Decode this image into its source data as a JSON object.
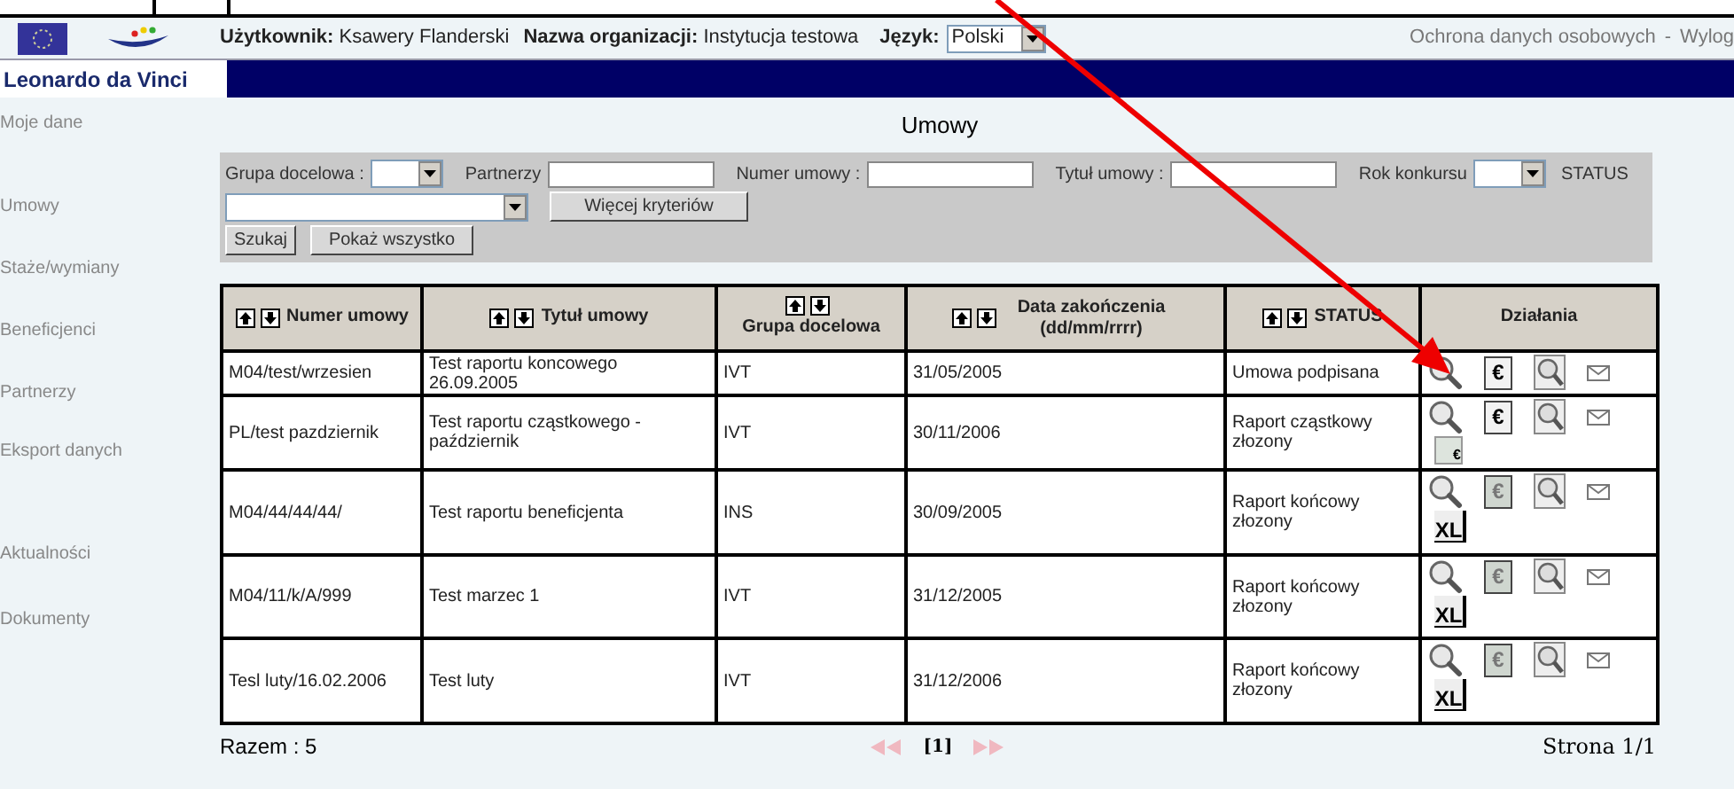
{
  "header": {
    "user_label": "Użytkownik:",
    "user": "Ksawery Flanderski",
    "org_label": "Nazwa organizacji:",
    "org": "Instytucja testowa",
    "lang_label": "Język:",
    "lang": "Polski",
    "links": [
      "Ochrona danych osobowych",
      "-",
      "Wylog"
    ],
    "program": "Leonardo da Vinci"
  },
  "sidebar": {
    "items": [
      {
        "label": "Moje dane",
        "selected": false
      },
      {
        "label": "Umowy",
        "selected": false
      },
      {
        "label": "Staże/wymiany",
        "selected": false
      },
      {
        "label": "Beneficjenci",
        "selected": false
      },
      {
        "label": "Partnerzy",
        "selected": false
      },
      {
        "label": "Eksport danych",
        "selected": false
      },
      {
        "label": "Aktualności",
        "selected": false
      },
      {
        "label": "Dokumenty",
        "selected": false
      }
    ]
  },
  "title": "Umowy",
  "filters": {
    "group_label": "Grupa docelowa :",
    "partners_label": "Partnerzy",
    "number_label": "Numer umowy :",
    "title_label": "Tytuł umowy :",
    "year_label": "Rok konkursu",
    "status_label": "STATUS",
    "more_button": "Więcej kryteriów",
    "search_button": "Szukaj",
    "show_all_button": "Pokaż wszystko"
  },
  "table": {
    "columns": [
      {
        "label": "Numer umowy",
        "sortable": true
      },
      {
        "label": "Tytuł umowy",
        "sortable": true
      },
      {
        "label": "Grupa docelowa",
        "sortable": true
      },
      {
        "label": "Data zakończenia (dd/mm/rrrr)",
        "sortable": true
      },
      {
        "label": "STATUS",
        "sortable": true
      },
      {
        "label": "Działania",
        "sortable": false
      }
    ],
    "rows": [
      {
        "cells": [
          "M04/test/wrzesien",
          "Test raportu koncowego 26.09.2005",
          "IVT",
          "31/05/2005",
          "Umowa podpisana"
        ],
        "actions": [
          {
            "kind": "view"
          },
          {
            "kind": "invoice",
            "label": "€",
            "disabled": false
          },
          {
            "kind": "preview"
          },
          {
            "kind": "mail"
          }
        ]
      },
      {
        "cells": [
          "PL/test pazdziernik",
          "Test raportu cząstkowego - październik",
          "IVT",
          "30/11/2006",
          "Raport cząstkowy złozony"
        ],
        "actions": [
          {
            "kind": "view"
          },
          {
            "kind": "invoice",
            "label": "€",
            "disabled": false
          },
          {
            "kind": "preview"
          },
          {
            "kind": "mail"
          },
          {
            "kind": "sheet",
            "label": "€"
          }
        ]
      },
      {
        "cells": [
          "M04/44/44/44/",
          "Test raportu beneficjenta",
          "INS",
          "30/09/2005",
          "Raport końcowy złozony"
        ],
        "actions": [
          {
            "kind": "view"
          },
          {
            "kind": "invoice",
            "label": "€",
            "disabled": true
          },
          {
            "kind": "preview"
          },
          {
            "kind": "mail"
          },
          {
            "kind": "excel",
            "label": "XL"
          }
        ]
      },
      {
        "cells": [
          "M04/11/k/A/999",
          "Test marzec 1",
          "IVT",
          "31/12/2005",
          "Raport końcowy złozony"
        ],
        "actions": [
          {
            "kind": "view"
          },
          {
            "kind": "invoice",
            "label": "€",
            "disabled": true
          },
          {
            "kind": "preview"
          },
          {
            "kind": "mail"
          },
          {
            "kind": "excel",
            "label": "XL"
          }
        ]
      },
      {
        "cells": [
          "Tesl luty/16.02.2006",
          "Test luty",
          "IVT",
          "31/12/2006",
          "Raport końcowy złozony"
        ],
        "actions": [
          {
            "kind": "view"
          },
          {
            "kind": "invoice",
            "label": "€",
            "disabled": true
          },
          {
            "kind": "preview"
          },
          {
            "kind": "mail"
          },
          {
            "kind": "excel",
            "label": "XL"
          }
        ]
      }
    ]
  },
  "footer": {
    "total": "Razem : 5",
    "page_link": "[1]",
    "page": "Strona 1/1"
  }
}
